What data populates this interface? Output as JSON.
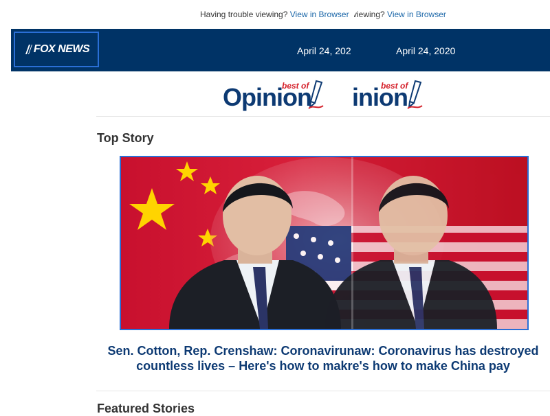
{
  "topbar": {
    "trouble_text": "Having trouble viewing?",
    "view_link": "View in Browser",
    "trouble_text_dup": "viewing?",
    "view_link_dup": "View in Browser"
  },
  "header": {
    "logo_text": "FOX NEWS",
    "date": "April 24, 2020",
    "date_dup": "April 24, 2020"
  },
  "opinion_logo": {
    "best_of": "best of",
    "word": "Opinion",
    "word_dup": "inion"
  },
  "top_story": {
    "section_title": "Top Story",
    "image_alt": "Xi Jinping in front of China and US flags",
    "headline_line1": "Sen. Cotton, Rep. Crenshaw: Coronavirunaw: Coronavirus has destroyed",
    "headline_line2": "countless lives – Here's how to makre's how to make China pay"
  },
  "featured": {
    "section_title": "Featured Stories"
  },
  "colors": {
    "navy": "#003366",
    "link_blue": "#1a66a8",
    "headline_blue": "#0d3a73",
    "accent_red": "#d4202a",
    "selection_border": "#2a6fd6"
  }
}
